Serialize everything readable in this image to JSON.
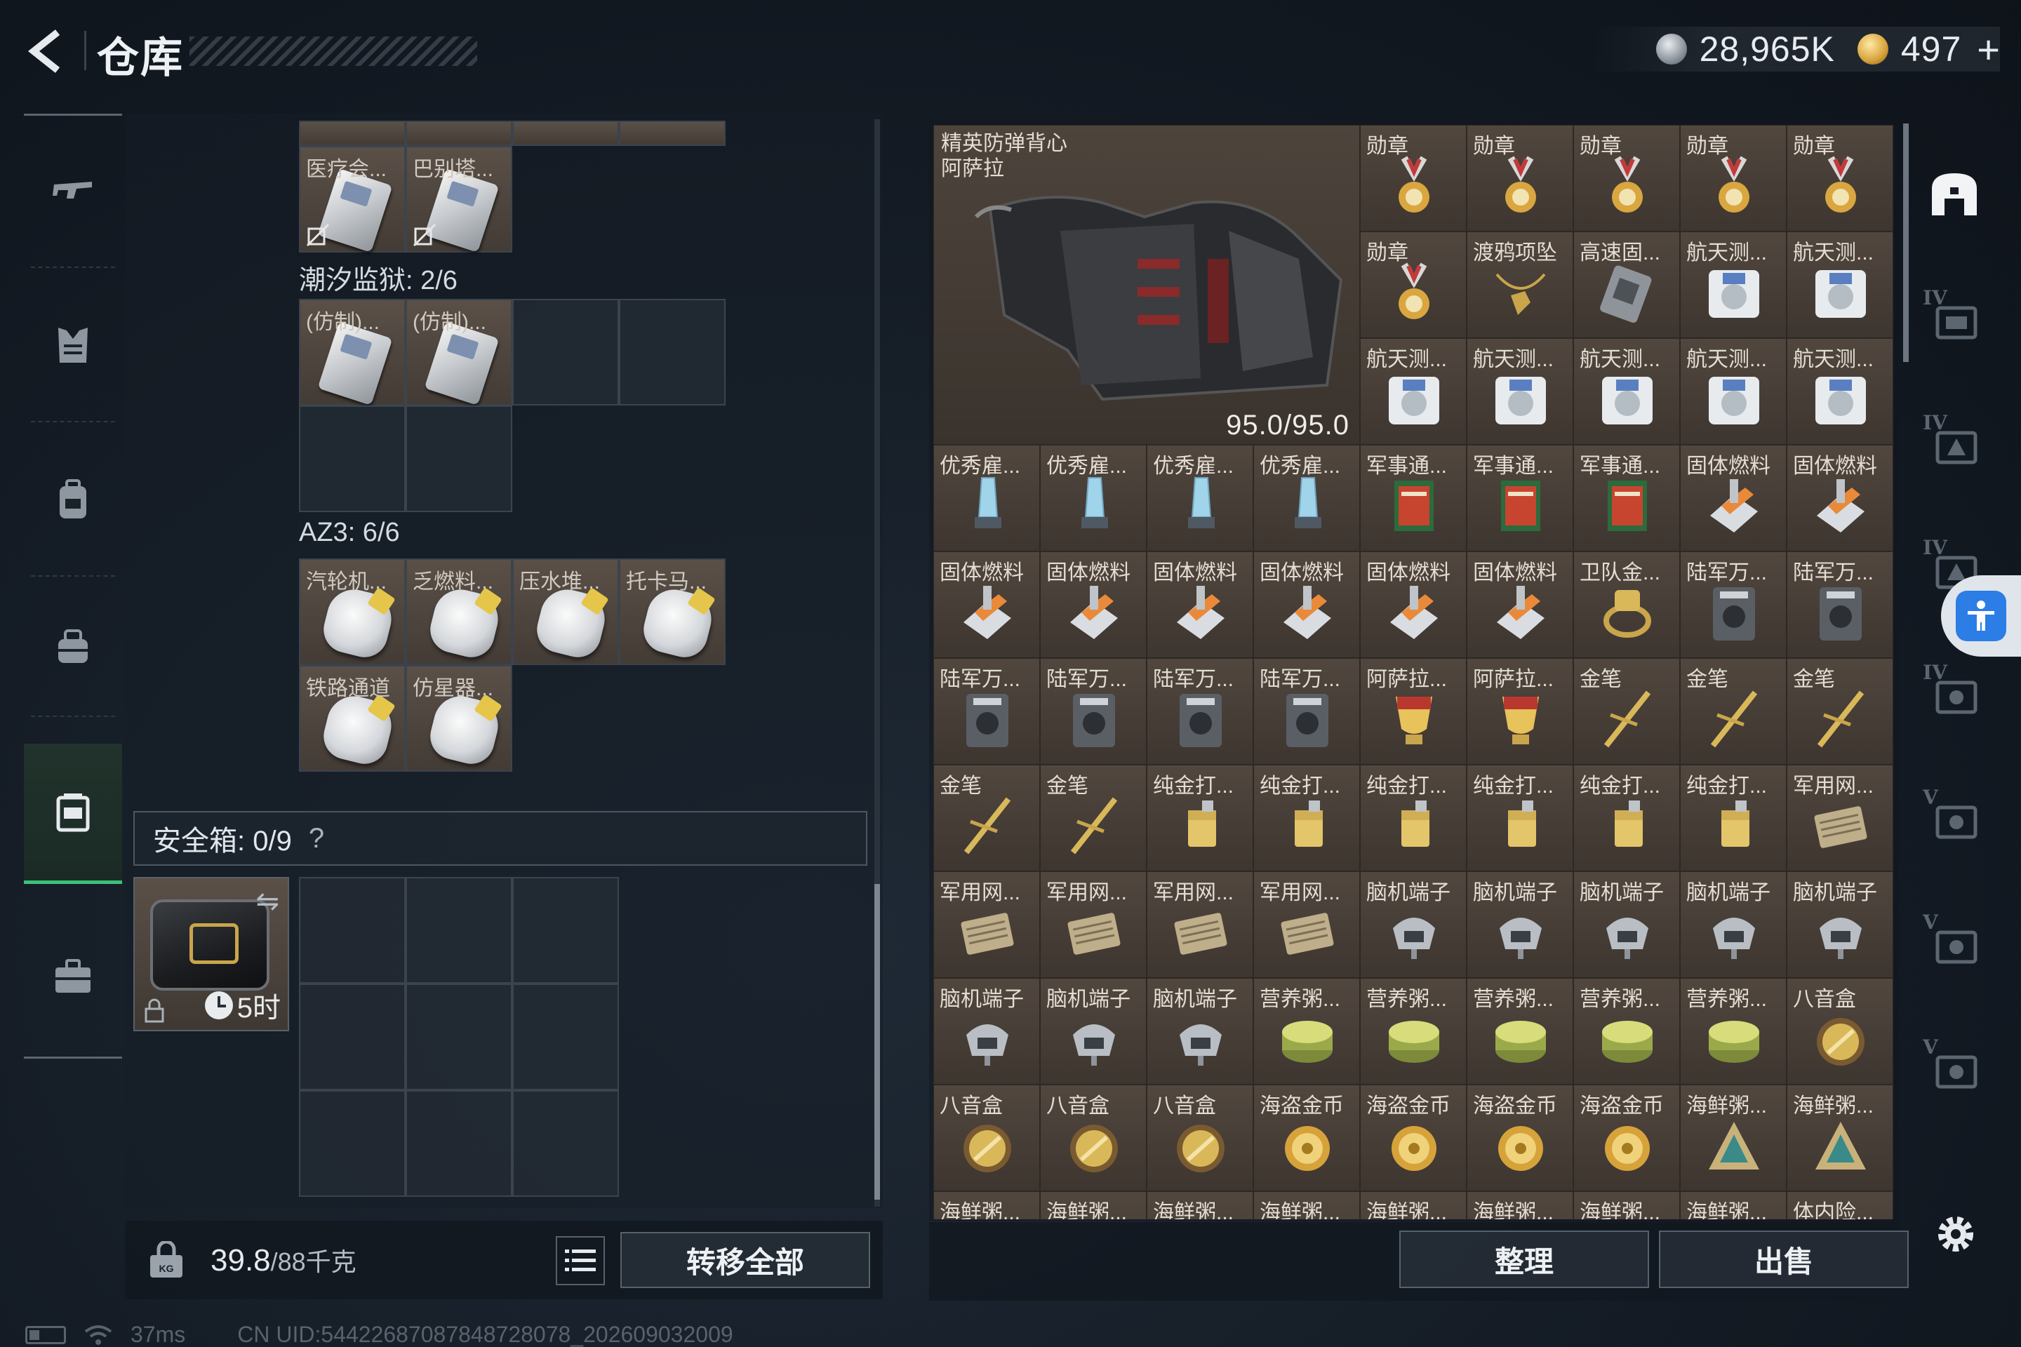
{
  "header": {
    "title": "仓库",
    "currency_silver": "28,965K",
    "currency_gold": "497",
    "plus": "+"
  },
  "left_nav": {
    "items": [
      {
        "icon": "rifle-icon"
      },
      {
        "icon": "armor-icon"
      },
      {
        "icon": "backpack-icon"
      },
      {
        "icon": "rig-icon"
      },
      {
        "icon": "container-icon",
        "active": true
      },
      {
        "icon": "briefcase-icon"
      }
    ]
  },
  "containers": {
    "top_row_labels": [
      "医疗会...",
      "巴别塔..."
    ],
    "tide_prison": {
      "label": "潮汐监狱: 2/6",
      "items": [
        "(仿制)...",
        "(仿制)..."
      ]
    },
    "az3": {
      "label": "AZ3: 6/6",
      "items": [
        "汽轮机...",
        "乏燃料...",
        "压水堆...",
        "托卡马...",
        "铁路通道",
        "仿星器..."
      ]
    },
    "safe": {
      "label": "安全箱: 0/9",
      "help": "?",
      "timer": "5时"
    }
  },
  "footer_left": {
    "weight": "39.8",
    "capacity": "/88千克",
    "transfer_all": "转移全部"
  },
  "storage": {
    "vest": {
      "name_line1": "精英防弹背心",
      "name_line2": "阿萨拉",
      "durability": "95.0/95.0"
    },
    "rows": [
      [
        "勋章",
        "勋章",
        "勋章",
        "勋章",
        "勋章"
      ],
      [
        "勋章",
        "渡鸦项坠",
        "高速固...",
        "航天测...",
        "航天测..."
      ],
      [
        "航天测...",
        "航天测...",
        "航天测...",
        "航天测...",
        "航天测..."
      ],
      [
        "优秀雇...",
        "优秀雇...",
        "优秀雇...",
        "优秀雇...",
        "军事通...",
        "军事通...",
        "军事通...",
        "固体燃料",
        "固体燃料"
      ],
      [
        "固体燃料",
        "固体燃料",
        "固体燃料",
        "固体燃料",
        "固体燃料",
        "固体燃料",
        "卫队金...",
        "陆军万...",
        "陆军万..."
      ],
      [
        "陆军万...",
        "陆军万...",
        "陆军万...",
        "陆军万...",
        "阿萨拉...",
        "阿萨拉...",
        "金笔",
        "金笔",
        "金笔"
      ],
      [
        "金笔",
        "金笔",
        "纯金打...",
        "纯金打...",
        "纯金打...",
        "纯金打...",
        "纯金打...",
        "纯金打...",
        "军用网..."
      ],
      [
        "军用网...",
        "军用网...",
        "军用网...",
        "军用网...",
        "脑机端子",
        "脑机端子",
        "脑机端子",
        "脑机端子",
        "脑机端子"
      ],
      [
        "脑机端子",
        "脑机端子",
        "脑机端子",
        "营养粥...",
        "营养粥...",
        "营养粥...",
        "营养粥...",
        "营养粥...",
        "八音盒"
      ],
      [
        "八音盒",
        "八音盒",
        "八音盒",
        "海盗金币",
        "海盗金币",
        "海盗金币",
        "海盗金币",
        "海鲜粥...",
        "海鲜粥..."
      ],
      [
        "海鲜粥...",
        "海鲜粥...",
        "海鲜粥...",
        "海鲜粥...",
        "海鲜粥...",
        "海鲜粥...",
        "海鲜粥...",
        "海鲜粥...",
        "体内险..."
      ]
    ],
    "sort_label": "整理",
    "sell_label": "出售"
  },
  "right_tabs": [
    "IV",
    "IV",
    "IV",
    "IV",
    "V",
    "V",
    "V"
  ],
  "status": {
    "ping": "37ms",
    "uid": "CN UID:5442268708784872807​8_202609032009"
  },
  "colors": {
    "accent_green": "#3cc07a",
    "item_cell": "#4a4139",
    "assist_blue": "#2c7de6"
  }
}
